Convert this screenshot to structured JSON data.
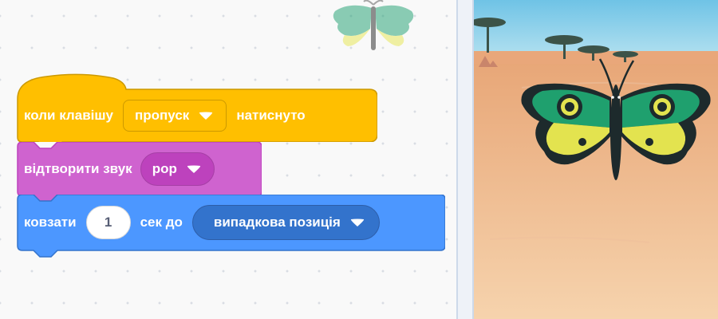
{
  "blocks": {
    "event": {
      "label_before": "коли клавішу",
      "dropdown_value": "пропуск",
      "label_after": "натиснуто"
    },
    "sound": {
      "label": "відтворити звук",
      "dropdown_value": "pop"
    },
    "motion": {
      "label_before": "ковзати",
      "number_value": "1",
      "label_mid": "сек до",
      "dropdown_value": "випадкова позиція"
    }
  },
  "colors": {
    "events": "#ffbf00",
    "sound": "#cf63cf",
    "motion": "#4c97ff",
    "workspace": "#f9f9f9"
  },
  "icons": [
    "dropdown-caret-icon",
    "butterfly-sprite",
    "savanna-backdrop"
  ]
}
